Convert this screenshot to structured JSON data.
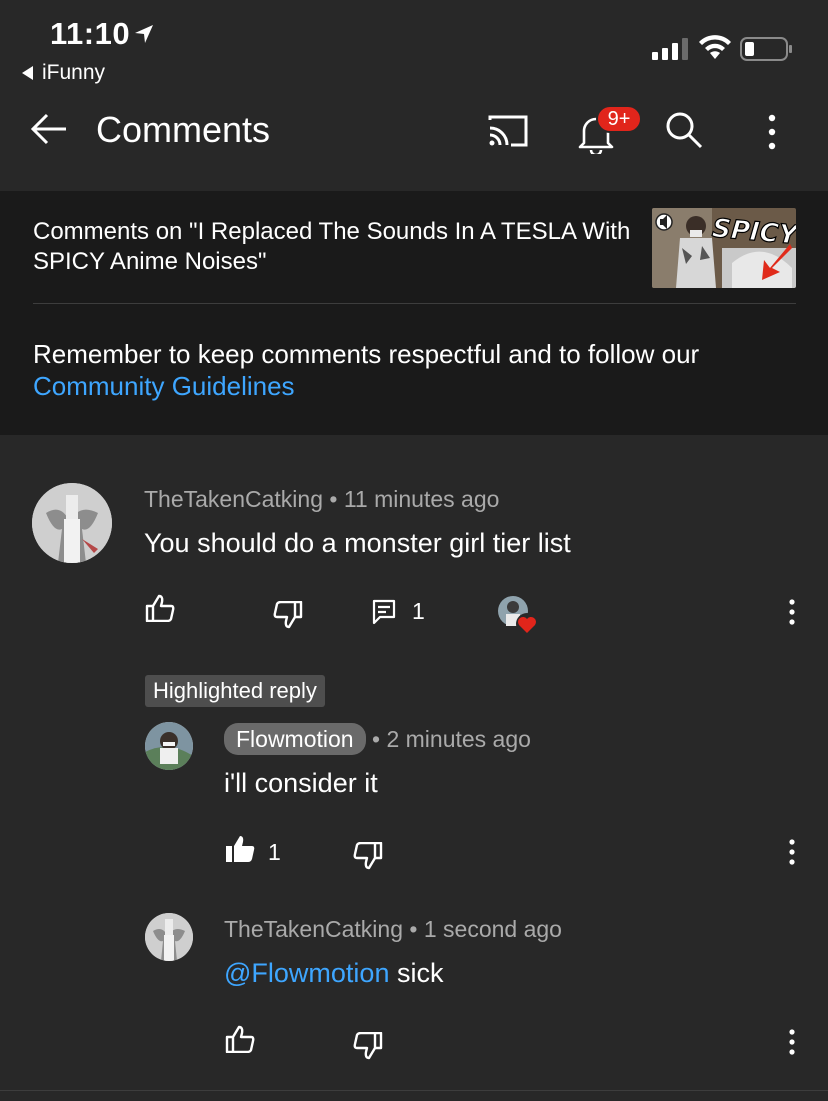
{
  "status_bar": {
    "time": "11:10",
    "back_app": "iFunny"
  },
  "app_bar": {
    "title": "Comments",
    "notification_count": "9+"
  },
  "video": {
    "title": "Comments on \"I Replaced The Sounds In A TESLA With SPICY Anime Noises\"",
    "thumbnail_text": "SPICY"
  },
  "guidelines": {
    "text": "Remember to keep comments respectful and to follow our ",
    "link": "Community Guidelines"
  },
  "comment": {
    "author": "TheTakenCatking",
    "time": "11 minutes ago",
    "text": "You should do a monster girl tier list",
    "reply_count": "1"
  },
  "highlighted_label": "Highlighted reply",
  "reply1": {
    "author": "Flowmotion",
    "time": "2 minutes ago",
    "text": "i'll consider it",
    "like_count": "1"
  },
  "reply2": {
    "author": "TheTakenCatking",
    "time": "1 second ago",
    "mention": "@Flowmotion",
    "text": " sick"
  },
  "separator": "•",
  "colors": {
    "link": "#3ea6ff",
    "badge": "#e1251b",
    "heart": "#e1251b"
  }
}
